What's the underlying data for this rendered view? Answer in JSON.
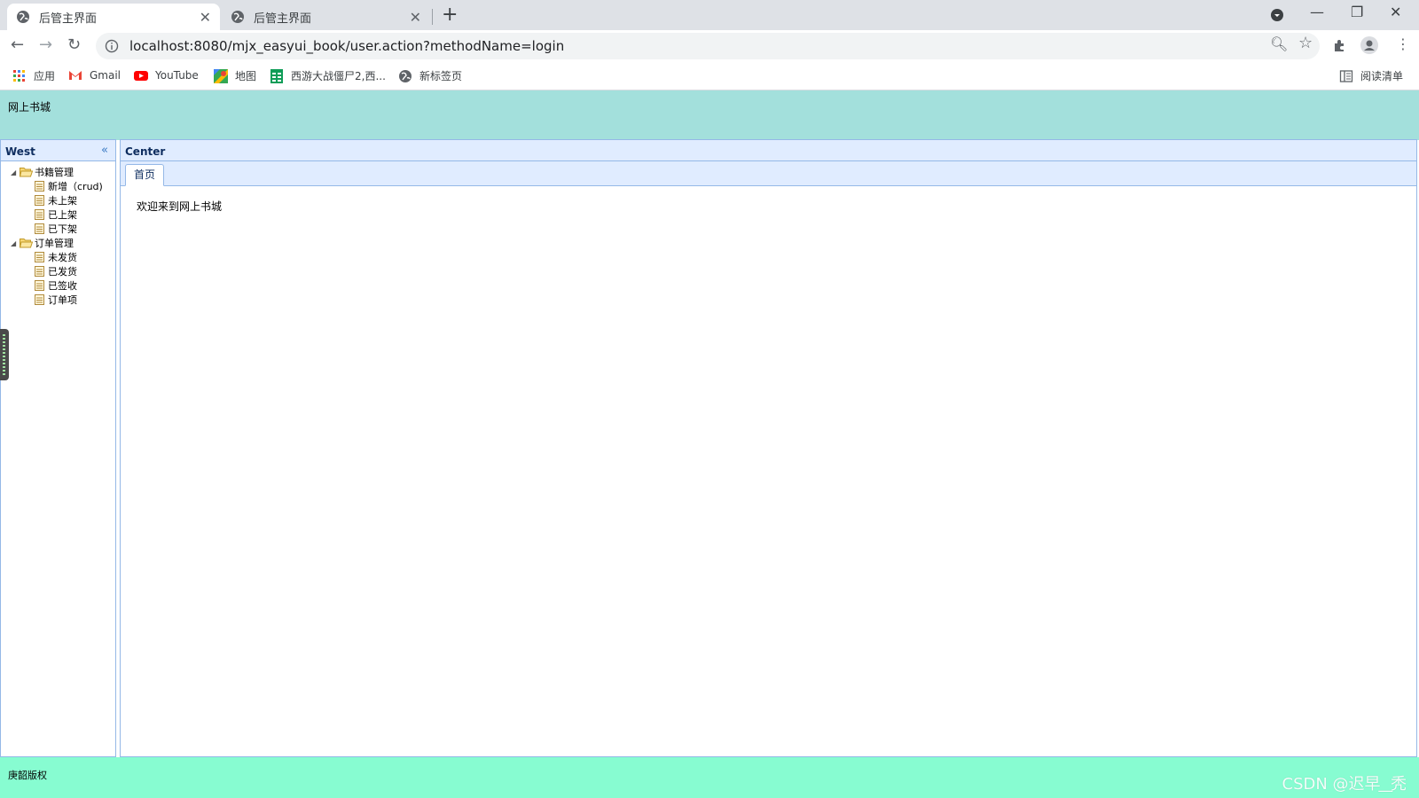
{
  "browser": {
    "tabs": [
      {
        "title": "后管主界面",
        "active": true
      },
      {
        "title": "后管主界面",
        "active": false
      }
    ],
    "new_tab": "+",
    "url": "localhost:8080/mjx_easyui_book/user.action?methodName=login",
    "bookmarks": [
      {
        "label": "应用",
        "icon": "apps-grid-icon"
      },
      {
        "label": "Gmail",
        "icon": "gmail-icon"
      },
      {
        "label": "YouTube",
        "icon": "youtube-icon"
      },
      {
        "label": "地图",
        "icon": "maps-icon"
      },
      {
        "label": "西游大战僵尸2,西...",
        "icon": "sheet-icon"
      },
      {
        "label": "新标签页",
        "icon": "globe-icon"
      }
    ],
    "reading_list": "阅读清单"
  },
  "north": {
    "title": "网上书城"
  },
  "west": {
    "title": "West",
    "tree": [
      {
        "label": "书籍管理",
        "children": [
          "新增（crud)",
          "未上架",
          "已上架",
          "已下架"
        ]
      },
      {
        "label": "订单管理",
        "children": [
          "未发货",
          "已发货",
          "已签收",
          "订单项"
        ]
      }
    ]
  },
  "center": {
    "title": "Center",
    "tab": "首页",
    "welcome": "欢迎来到网上书城"
  },
  "south": {
    "text": "庚韶版权"
  },
  "watermark": "CSDN @迟早 ͟ 秃",
  "colors": {
    "north_bg": "#a3e0dc",
    "south_bg": "#87fcd1",
    "panel_header": "#e0ecff",
    "panel_border": "#95b8e7"
  }
}
